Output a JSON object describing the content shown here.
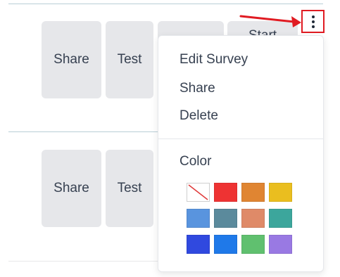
{
  "rows": [
    {
      "share_label": "Share",
      "test_label": "Test",
      "start_label": "Start"
    },
    {
      "share_label": "Share",
      "test_label": "Test"
    }
  ],
  "menu": {
    "items": [
      "Edit Survey",
      "Share",
      "Delete"
    ],
    "color_heading": "Color",
    "swatches": [
      {
        "name": "no-color-swatch",
        "color": "none"
      },
      {
        "name": "red-swatch",
        "color": "#ee3333"
      },
      {
        "name": "orange-swatch",
        "color": "#e08532"
      },
      {
        "name": "yellow-swatch",
        "color": "#eabe1f"
      },
      {
        "name": "light-blue-swatch",
        "color": "#5994de"
      },
      {
        "name": "slate-blue-swatch",
        "color": "#5b8a9c"
      },
      {
        "name": "salmon-swatch",
        "color": "#df8a68"
      },
      {
        "name": "teal-swatch",
        "color": "#3ca69c"
      },
      {
        "name": "blue-swatch",
        "color": "#3049df"
      },
      {
        "name": "bright-blue-swatch",
        "color": "#1f79e9"
      },
      {
        "name": "green-swatch",
        "color": "#60c06f"
      },
      {
        "name": "purple-swatch",
        "color": "#9979e3"
      }
    ]
  },
  "annotation": {
    "arrow_color": "#e01b22"
  },
  "icons": {
    "kebab": "kebab-vertical-icon",
    "arrow": "red-arrow-icon"
  }
}
